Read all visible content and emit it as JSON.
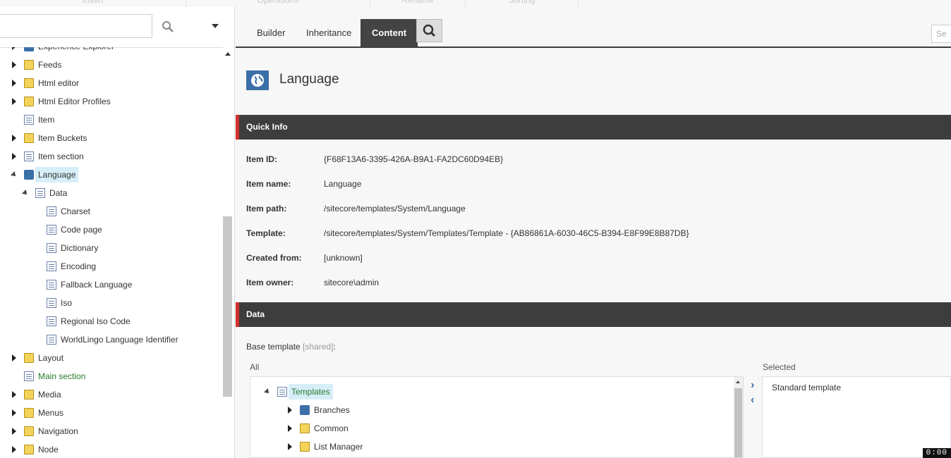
{
  "ribbon": {
    "groups": [
      "Insert",
      "Operations",
      "Rename",
      "Sorting"
    ]
  },
  "left_search": {
    "placeholder": ""
  },
  "tree": [
    {
      "label": "Experience Explorer",
      "type": "special",
      "state": "collapsed"
    },
    {
      "label": "Feeds",
      "type": "folder",
      "state": "collapsed"
    },
    {
      "label": "Html editor",
      "type": "folder",
      "state": "collapsed"
    },
    {
      "label": "Html Editor Profiles",
      "type": "folder",
      "state": "collapsed"
    },
    {
      "label": "Item",
      "type": "doc",
      "state": "leaf"
    },
    {
      "label": "Item Buckets",
      "type": "folder",
      "state": "collapsed"
    },
    {
      "label": "Item section",
      "type": "doc",
      "state": "collapsed"
    },
    {
      "label": "Language",
      "type": "globe",
      "state": "expanded",
      "selected": true
    },
    {
      "label": "Data",
      "type": "doc",
      "state": "expanded"
    },
    {
      "label": "Charset",
      "type": "doc",
      "state": "leaf"
    },
    {
      "label": "Code page",
      "type": "doc",
      "state": "leaf"
    },
    {
      "label": "Dictionary",
      "type": "doc",
      "state": "leaf"
    },
    {
      "label": "Encoding",
      "type": "doc",
      "state": "leaf"
    },
    {
      "label": "Fallback Language",
      "type": "doc",
      "state": "leaf"
    },
    {
      "label": "Iso",
      "type": "doc",
      "state": "leaf"
    },
    {
      "label": "Regional Iso Code",
      "type": "doc",
      "state": "leaf"
    },
    {
      "label": "WorldLingo Language Identifier",
      "type": "doc",
      "state": "leaf"
    },
    {
      "label": "Layout",
      "type": "folder",
      "state": "collapsed"
    },
    {
      "label": "Main section",
      "type": "doc",
      "state": "leaf",
      "green": true
    },
    {
      "label": "Media",
      "type": "folder",
      "state": "collapsed"
    },
    {
      "label": "Menus",
      "type": "folder",
      "state": "collapsed"
    },
    {
      "label": "Navigation",
      "type": "folder",
      "state": "collapsed"
    },
    {
      "label": "Node",
      "type": "folder",
      "state": "collapsed"
    }
  ],
  "tabs": [
    "Builder",
    "Inheritance",
    "Content"
  ],
  "active_tab": "Content",
  "right_search_placeholder": "Se",
  "page_title": "Language",
  "quick_info": {
    "title": "Quick Info",
    "rows": [
      {
        "label": "Item ID:",
        "value": "{F68F13A6-3395-426A-B9A1-FA2DC60D94EB}"
      },
      {
        "label": "Item name:",
        "value": "Language"
      },
      {
        "label": "Item path:",
        "value": "/sitecore/templates/System/Language"
      },
      {
        "label": "Template:",
        "value": "/sitecore/templates/System/Templates/Template - {AB86861A-6030-46C5-B394-E8F99E8B87DB}"
      },
      {
        "label": "Created from:",
        "value": "[unknown]"
      },
      {
        "label": "Item owner:",
        "value": "sitecore\\admin"
      }
    ]
  },
  "data_section": {
    "title": "Data",
    "base_template_label": "Base template",
    "shared_tag": "[shared]",
    "colon": ":",
    "all_label": "All",
    "selected_label": "Selected",
    "all_tree": [
      {
        "label": "Templates",
        "type": "doc",
        "state": "expanded",
        "selected": true
      },
      {
        "label": "Branches",
        "type": "branch",
        "state": "collapsed"
      },
      {
        "label": "Common",
        "type": "folder",
        "state": "collapsed"
      },
      {
        "label": "List Manager",
        "type": "folder",
        "state": "collapsed"
      }
    ],
    "selected_items": [
      "Standard template"
    ]
  },
  "clock": "0:00"
}
